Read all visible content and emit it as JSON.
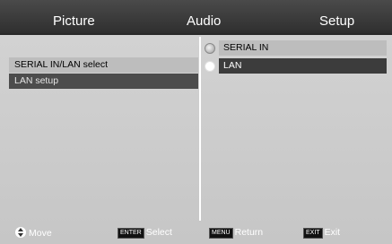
{
  "tabs": [
    {
      "label": "Picture"
    },
    {
      "label": "Audio"
    },
    {
      "label": "Setup"
    }
  ],
  "menu": {
    "items": [
      {
        "label": "SERIAL IN/LAN select"
      },
      {
        "label": "LAN setup"
      }
    ]
  },
  "options": [
    {
      "label": "SERIAL IN",
      "selected": false
    },
    {
      "label": "LAN",
      "selected": true
    }
  ],
  "footer": {
    "move": {
      "icon": "dpad-icon",
      "label": "Move"
    },
    "select": {
      "key": "ENTER",
      "label": "Select"
    },
    "return": {
      "key": "MENU",
      "label": "Return"
    },
    "exit": {
      "key": "EXIT",
      "label": "Exit"
    }
  }
}
